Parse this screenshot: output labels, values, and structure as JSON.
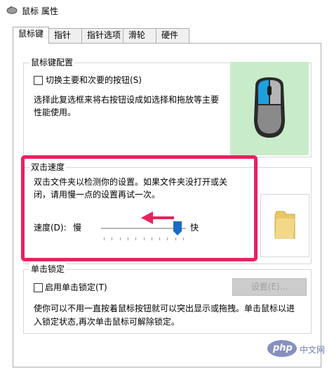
{
  "window": {
    "title": "鼠标 属性"
  },
  "tabs": [
    {
      "label": "鼠标键"
    },
    {
      "label": "指针"
    },
    {
      "label": "指针选项"
    },
    {
      "label": "滑轮"
    },
    {
      "label": "硬件"
    }
  ],
  "mouse_config": {
    "title": "鼠标键配置",
    "swap_label": "切换主要和次要的按钮(S)",
    "desc_line1": "选择此复选框来将右按钮设成如选择和拖放等主要",
    "desc_line2": "性能使用。",
    "swap_checked": false
  },
  "double_click": {
    "title": "双击速度",
    "desc_line1": "双击文件夹以检测你的设置。如果文件夹没打开或关",
    "desc_line2": "闭，请用慢一点的设置再试一次。",
    "speed_label": "速度(D):",
    "slow_label": "慢",
    "fast_label": "快",
    "speed_value": 0.9
  },
  "click_lock": {
    "title": "单击锁定",
    "enable_label": "启用单击锁定(T)",
    "enable_checked": false,
    "settings_button": "设置(E)...",
    "desc_line1": "使你可以不用一直按着鼠标按钮就可以突出显示或拖拽。单击鼠标以进",
    "desc_line2": "入锁定状态,再次单击鼠标可解除锁定。"
  },
  "watermark": {
    "logo_text": "php",
    "site_text": "中文网"
  },
  "colors": {
    "highlight": "#e8225f",
    "mouse_bg": "#c8ecca",
    "slider_thumb": "#1a6bc4"
  }
}
